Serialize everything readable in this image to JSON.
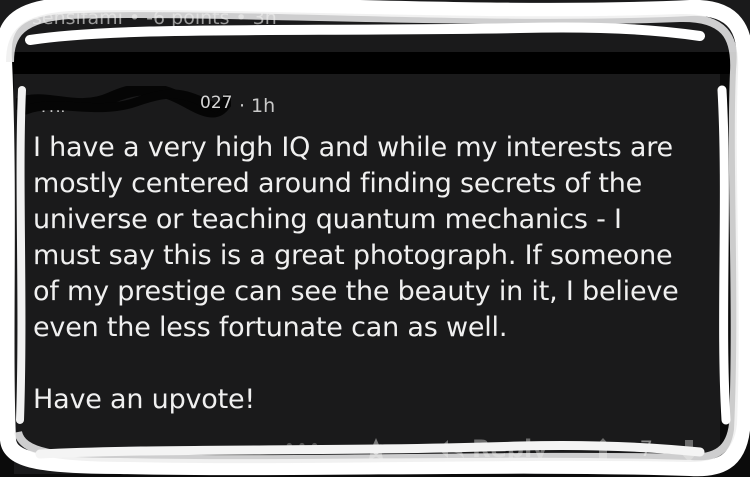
{
  "parent": {
    "username": "sensifami",
    "points": "-6 points",
    "time": "3h"
  },
  "comment": {
    "author_partial": "Thi",
    "author_suffix": "027",
    "time": "1h",
    "body": [
      "I have a very high IQ and while my interests are",
      "mostly centered around finding secrets of the",
      "universe or teaching quantum mechanics - I",
      "must say this is a great photograph. If someone",
      "of my prestige can see the beauty in it, I believe",
      "even the less fortunate can as well."
    ],
    "closing": "Have an upvote!"
  },
  "actions": {
    "reply_label": "Reply",
    "score": "-7"
  },
  "icons": {
    "more": "more-icon",
    "award": "award-icon",
    "reply": "reply-icon",
    "upvote": "upvote-icon",
    "downvote": "downvote-icon"
  },
  "colors": {
    "background": "#0b0b0b",
    "card": "#1a1a1b",
    "text": "#f0f0f0",
    "meta": "#9a9a9a",
    "marker": "#ffffff"
  }
}
